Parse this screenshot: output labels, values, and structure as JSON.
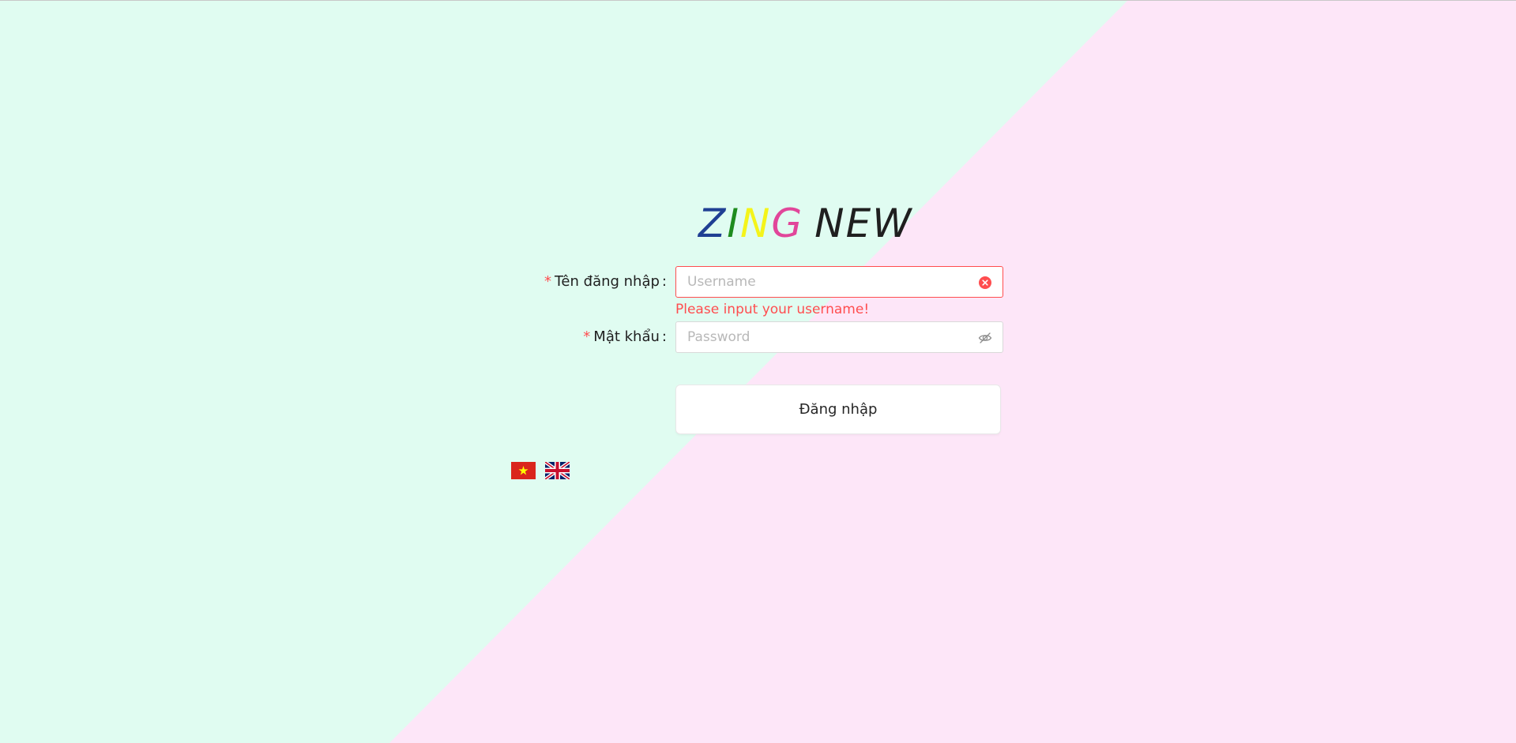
{
  "brand": {
    "letters": [
      "Z",
      "I",
      "N",
      "G"
    ],
    "suffix": "NEW",
    "colors": [
      "#1f3f93",
      "#1e8c1e",
      "#f4f41a",
      "#e1469a",
      "#1f1f1f"
    ]
  },
  "background": {
    "left_color": "#e0fcf1",
    "right_color": "#fde6f8"
  },
  "form": {
    "username": {
      "required_mark": "*",
      "label": "Tên đăng nhập",
      "colon": ":",
      "placeholder": "Username",
      "value": "",
      "suffix_icon": "error-circle-icon",
      "status": "error",
      "error_message": "Please input your username!"
    },
    "password": {
      "required_mark": "*",
      "label": "Mật khẩu",
      "colon": ":",
      "placeholder": "Password",
      "value": "",
      "suffix_icon": "eye-invisible-icon"
    },
    "submit_label": "Đăng nhập"
  },
  "languages": [
    {
      "code": "vi",
      "icon": "vietnam-flag-icon"
    },
    {
      "code": "en",
      "icon": "uk-flag-icon"
    }
  ],
  "colors": {
    "error": "#ff4d4f",
    "border": "#d9d9d9"
  }
}
